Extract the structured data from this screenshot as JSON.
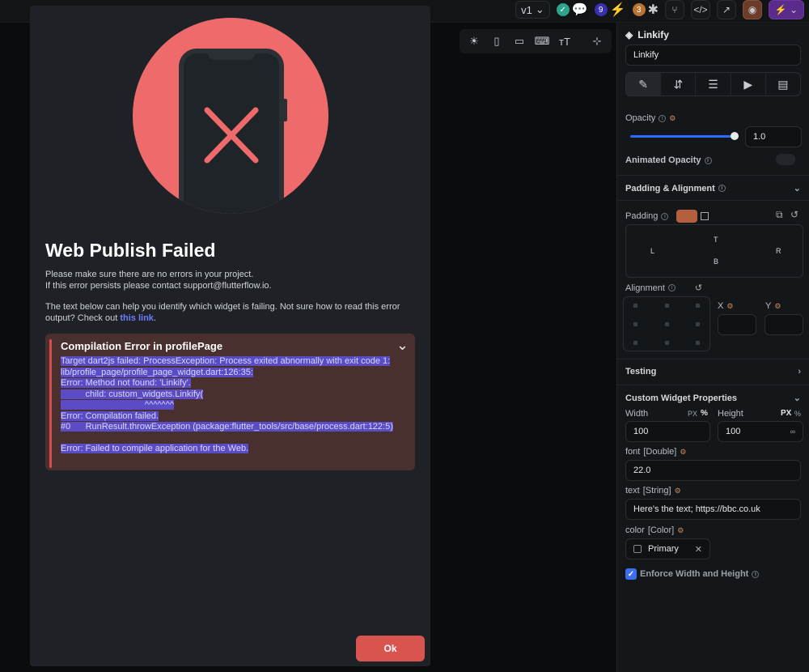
{
  "toolbar": {
    "version": "v1",
    "badge_issues": "9",
    "badge_warnings": "3"
  },
  "panel": {
    "widget_name_label": "Linkify",
    "widget_name_value": "Linkify",
    "opacity_label": "Opacity",
    "opacity_value": "1.0",
    "opacity_fraction": 1.0,
    "animated_opacity_label": "Animated Opacity",
    "padding_alignment_label": "Padding & Alignment",
    "padding_label": "Padding",
    "pad_top": "T",
    "pad_left": "L",
    "pad_right": "R",
    "pad_bottom": "B",
    "alignment_label": "Alignment",
    "x_label": "X",
    "y_label": "Y",
    "testing_label": "Testing",
    "custom_props_label": "Custom Widget Properties",
    "width_label": "Width",
    "width_unit_px": "PX",
    "width_unit_pct": "%",
    "width_value": "100",
    "height_label": "Height",
    "height_unit_px": "PX",
    "height_unit_pct": "%",
    "height_value": "100",
    "height_inf": "∞",
    "font_label": "font",
    "font_type": "[Double]",
    "font_value": "22.0",
    "text_label": "text",
    "text_type": "[String]",
    "text_value": "Here's the text; https://bbc.co.uk",
    "color_label": "color",
    "color_type": "[Color]",
    "color_value": "Primary",
    "enforce_label": "Enforce Width and Height"
  },
  "modal": {
    "title": "Web Publish Failed",
    "line1": "Please make sure there are no errors in your project.",
    "line2": "If this error persists please contact support@flutterflow.io.",
    "line3": "The text below can help you identify which widget is failing. Not sure how to read this error",
    "line4_prefix": "output? Check out ",
    "link_text": "this link",
    "line4_suffix": ".",
    "error_title": "Compilation Error in profilePage",
    "error_lines": [
      "Target dart2js failed: ProcessException: Process exited abnormally with exit code 1:",
      "lib/profile_page/profile_page_widget.dart:126:35:",
      "Error: Method not found: 'Linkify'.",
      "          child: custom_widgets.Linkify(",
      "                                  ^^^^^^^",
      "Error: Compilation failed.",
      "#0      RunResult.throwException (package:flutter_tools/src/base/process.dart:122:5)",
      "",
      "Error: Failed to compile application for the Web."
    ],
    "ok_label": "Ok"
  }
}
